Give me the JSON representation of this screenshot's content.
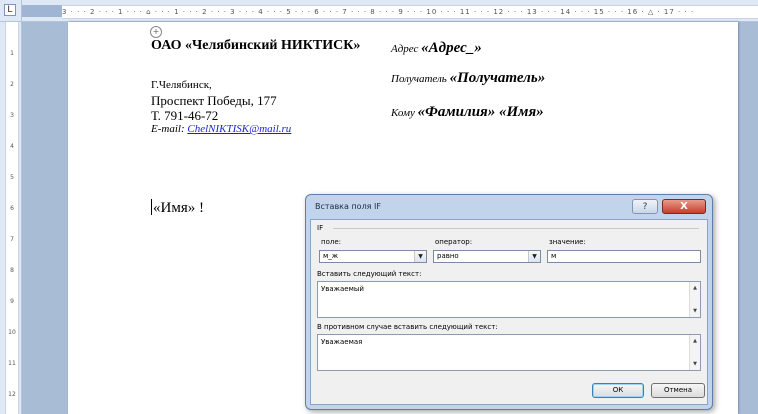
{
  "ruler": {
    "corner_icon": "tab-stop-icon",
    "horizontal_marks": "3 · · · 2 · · · 1 · · · ⌂ · · · 1 · · · 2 · · · 3 · · · 4 · · · 5 · · · 6 · · · 7 · · · 8 · · · 9 · · · 10 · · · 11 · · · 12 · · · 13 · · · 14 · · · 15 · · · 16 · △ · 17 · · ·",
    "vertical_marks": [
      "1",
      "2",
      "3",
      "4",
      "5",
      "6",
      "7",
      "8",
      "9",
      "10",
      "11",
      "12"
    ]
  },
  "document": {
    "org_name": "ОАО «Челябинский НИКТИСК»",
    "city": "Г.Челябинск,",
    "street": "Проспект Победы, 177",
    "phone": "Т. 791-46-72",
    "email_label": "E-mail: ",
    "email": "ChelNIKTISK@mail.ru",
    "address_label": "Адрес ",
    "address_field": "«Адрес_»",
    "recipient_label": "Получатель ",
    "recipient_field": "«Получатель»",
    "to_label": "Кому ",
    "to_field": "«Фамилия» «Имя»",
    "greeting": "«Имя» !"
  },
  "dialog": {
    "title": "Вставка поля IF",
    "help_label": "?",
    "close_label": "X",
    "section_if": "IF",
    "field_label": "поле:",
    "field_value": "м_ж",
    "operator_label": "оператор:",
    "operator_value": "равно",
    "value_label": "значение:",
    "value_value": "м",
    "insert_label": "Вставить следующий текст:",
    "insert_text": "Уважаемый",
    "else_label": "В противном случае вставить следующий текст:",
    "else_text": "Уважаемая",
    "ok_label": "ОК",
    "cancel_label": "Отмена"
  }
}
